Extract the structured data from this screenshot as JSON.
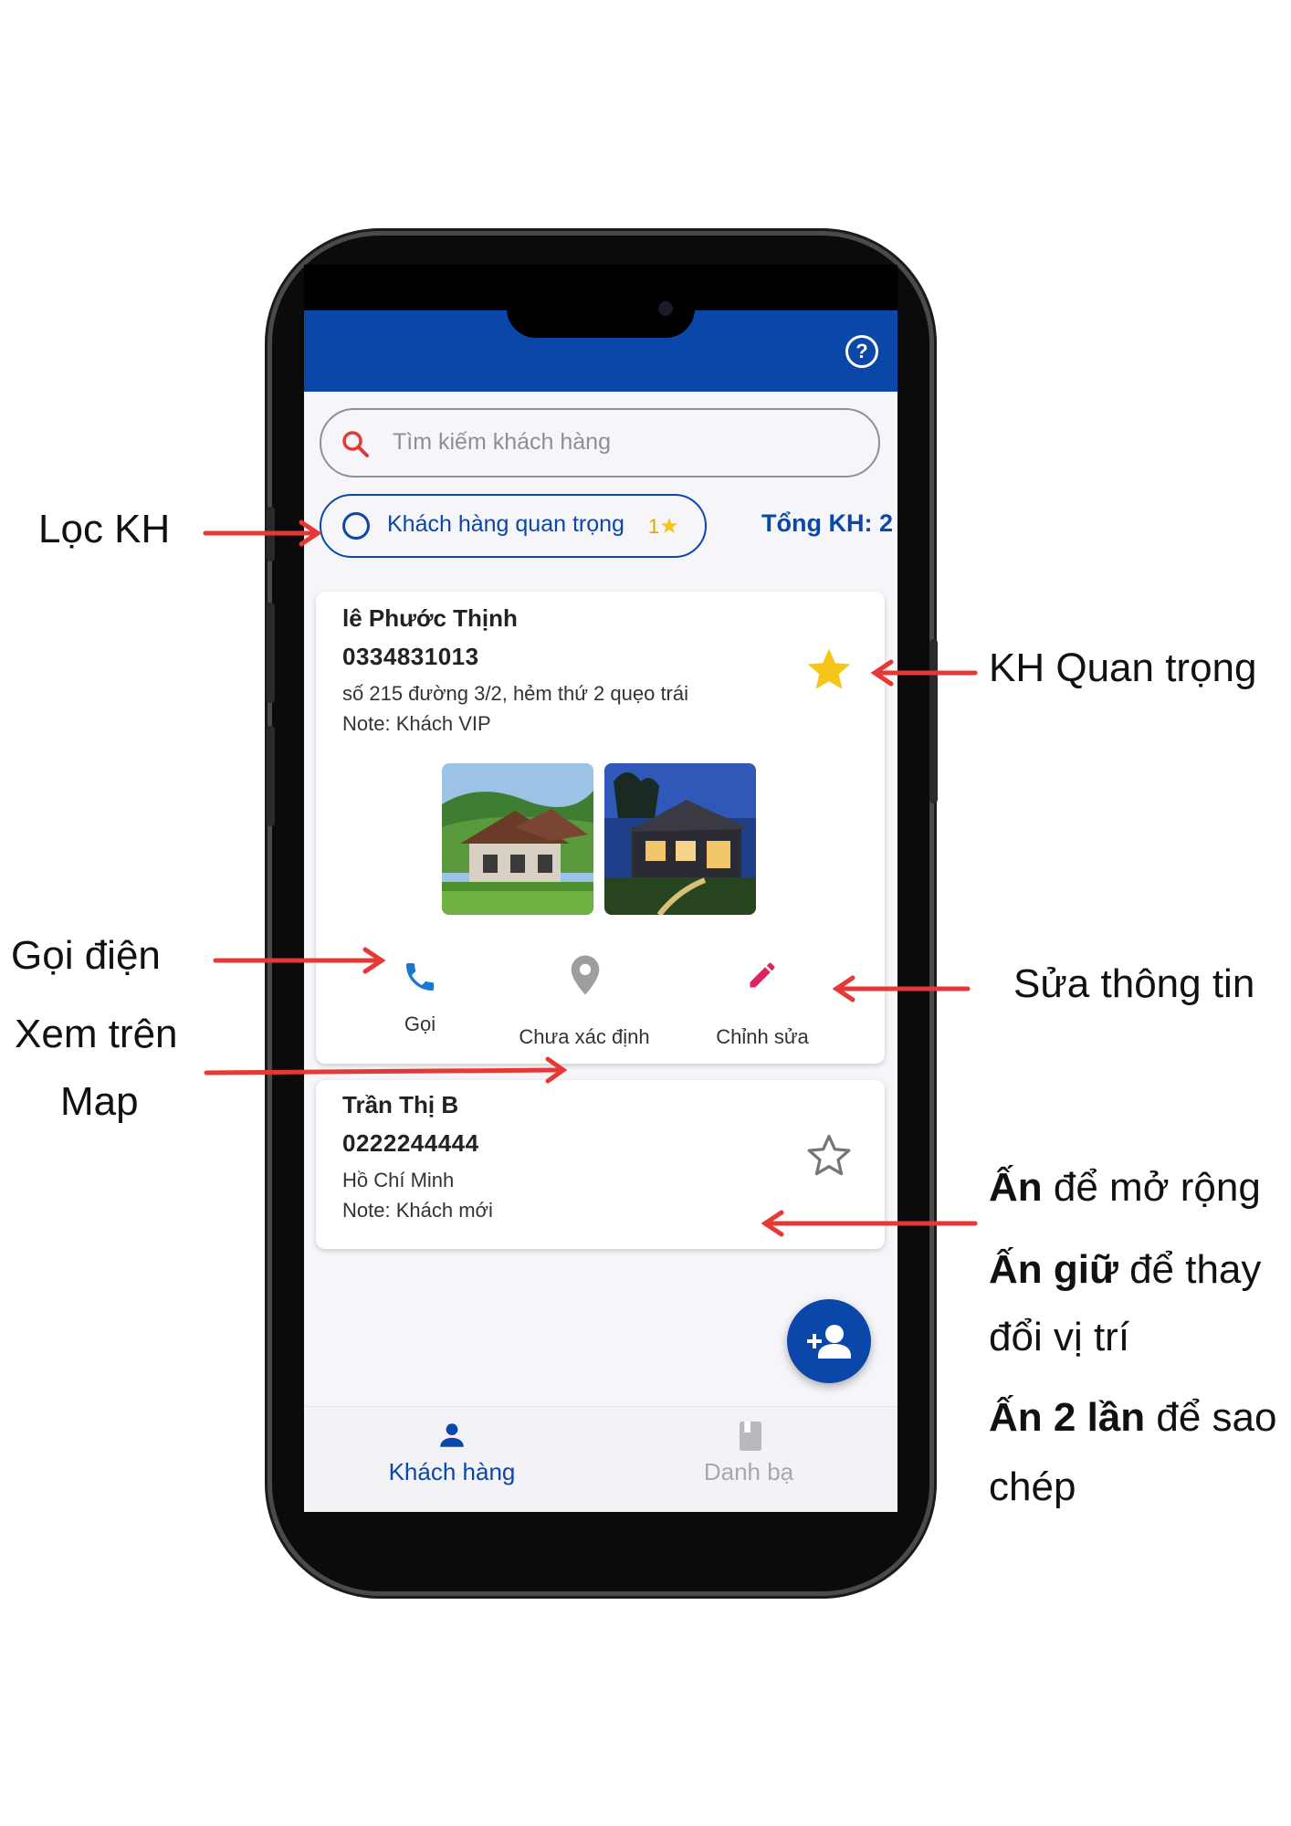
{
  "header": {
    "help_icon": "help-circle-icon",
    "bar_color": "#0a47a8"
  },
  "search": {
    "placeholder": "Tìm kiếm khách hàng",
    "icon": "search-icon"
  },
  "filter": {
    "label": "Khách hàng quan trọng",
    "count": "1",
    "star": "★"
  },
  "total": "Tổng KH: 2",
  "customers": [
    {
      "name": "lê Phước Thịnh",
      "phone": "0334831013",
      "address": "số 215 đường 3/2, hẻm thứ 2 quẹo trái",
      "note": "Note: Khách VIP",
      "important": true,
      "actions": {
        "call": "Gọi",
        "location": "Chưa xác định",
        "edit": "Chỉnh sửa"
      }
    },
    {
      "name": "Trần Thị B",
      "phone": "0222244444",
      "address": "Hồ Chí Minh",
      "note": "Note: Khách mới",
      "important": false
    }
  ],
  "fab": {
    "icon": "add-person-icon"
  },
  "tabs": [
    {
      "label": "Khách hàng",
      "active": true,
      "icon": "person-icon"
    },
    {
      "label": "Danh bạ",
      "active": false,
      "icon": "contacts-book-icon"
    }
  ],
  "annotations": {
    "filter": "Lọc KH",
    "important": "KH Quan trọng",
    "call": "Gọi điện",
    "map_line1": "Xem trên",
    "map_line2": "Map",
    "edit": "Sửa thông tin",
    "expand_bold": "Ấn",
    "expand_rest": " để mở rộng",
    "hold_bold": "Ấn giữ",
    "hold_rest": " để thay",
    "hold_line2": "đổi vị trí",
    "double_bold": "Ấn 2 lần",
    "double_rest": " để sao",
    "double_line2": "chép"
  },
  "colors": {
    "primary": "#0a47a8",
    "star": "#f5c518",
    "edit": "#e0245e",
    "arrow": "#e53935"
  }
}
